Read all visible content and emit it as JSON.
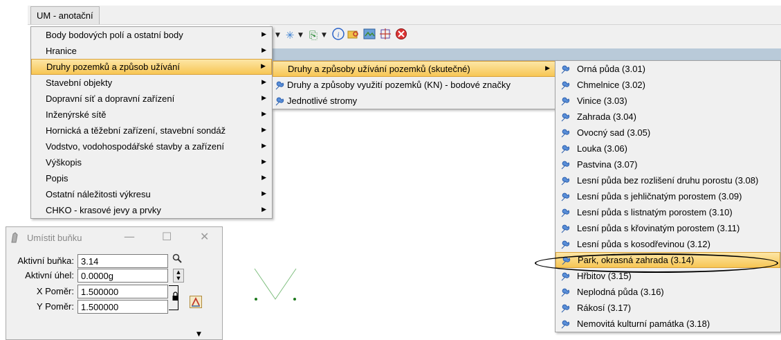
{
  "menubar": {
    "title": "UM - anotační"
  },
  "toolbar": {
    "icons": [
      "snap-icon",
      "attach-icon",
      "info-icon",
      "search-folder-icon",
      "grid-image-icon",
      "crosshair-icon",
      "delete-icon"
    ]
  },
  "menu1": {
    "items": [
      {
        "label": "Body bodových polí a ostatní body",
        "has_submenu": true
      },
      {
        "label": "Hranice",
        "has_submenu": true
      },
      {
        "label": "Druhy pozemků a způsob užívání",
        "has_submenu": true,
        "selected": true
      },
      {
        "label": "Stavební objekty",
        "has_submenu": true
      },
      {
        "label": "Dopravní síť a dopravní zařízení",
        "has_submenu": true
      },
      {
        "label": "Inženýrské sítě",
        "has_submenu": true
      },
      {
        "label": "Hornická a těžební zařízení, stavební sondáž",
        "has_submenu": true
      },
      {
        "label": "Vodstvo, vodohospodářské stavby a zařízení",
        "has_submenu": true
      },
      {
        "label": "Výškopis",
        "has_submenu": true
      },
      {
        "label": "Popis",
        "has_submenu": true
      },
      {
        "label": "Ostatní náležitosti výkresu",
        "has_submenu": true
      },
      {
        "label": "CHKO - krasové jevy a prvky",
        "has_submenu": true
      }
    ]
  },
  "menu2": {
    "items": [
      {
        "label": "Druhy a způsoby užívání pozemků (skutečné)",
        "has_submenu": true,
        "selected": true,
        "icon": ""
      },
      {
        "label": "Druhy a způsoby využití pozemků (KN) - bodové značky",
        "has_submenu": false,
        "icon": "wrench-icon"
      },
      {
        "label": "Jednotlivé stromy",
        "has_submenu": false,
        "icon": "wrench-icon"
      }
    ]
  },
  "menu3": {
    "items": [
      {
        "label": "Orná půda (3.01)"
      },
      {
        "label": "Chmelnice (3.02)"
      },
      {
        "label": "Vinice (3.03)"
      },
      {
        "label": "Zahrada (3.04)"
      },
      {
        "label": "Ovocný sad (3.05)"
      },
      {
        "label": "Louka (3.06)"
      },
      {
        "label": "Pastvina (3.07)"
      },
      {
        "label": "Lesní půda bez rozlišení druhu porostu (3.08)"
      },
      {
        "label": "Lesní půda s jehličnatým porostem (3.09)"
      },
      {
        "label": "Lesní půda s listnatým porostem (3.10)"
      },
      {
        "label": "Lesní půda s křovinatým porostem (3.11)"
      },
      {
        "label": "Lesní půda s kosodřevinou (3.12)"
      },
      {
        "label": "Park, okrasná zahrada (3.14)",
        "selected": true
      },
      {
        "label": "Hřbitov (3.15)"
      },
      {
        "label": "Neplodná půda (3.16)"
      },
      {
        "label": "Rákosí (3.17)"
      },
      {
        "label": "Nemovitá kulturní památka (3.18)"
      }
    ]
  },
  "dialog": {
    "title": "Umístit buňku",
    "minimize": "—",
    "maximize": "☐",
    "close": "✕",
    "active_cell_label": "Aktivní buňka:",
    "active_cell_value": "3.14",
    "active_angle_label": "Aktivní úhel:",
    "active_angle_value": "0.0000g",
    "x_scale_label": "X Poměr:",
    "x_scale_value": "1.500000",
    "y_scale_label": "Y Poměr:",
    "y_scale_value": "1.500000"
  },
  "colors": {
    "menu_bg": "#f0f0f0",
    "selection_bg": "#f7c654",
    "wrench_blue": "#3a73c4",
    "drawing_green": "#1e7a1e",
    "toolbar_band": "#b9cad9"
  }
}
